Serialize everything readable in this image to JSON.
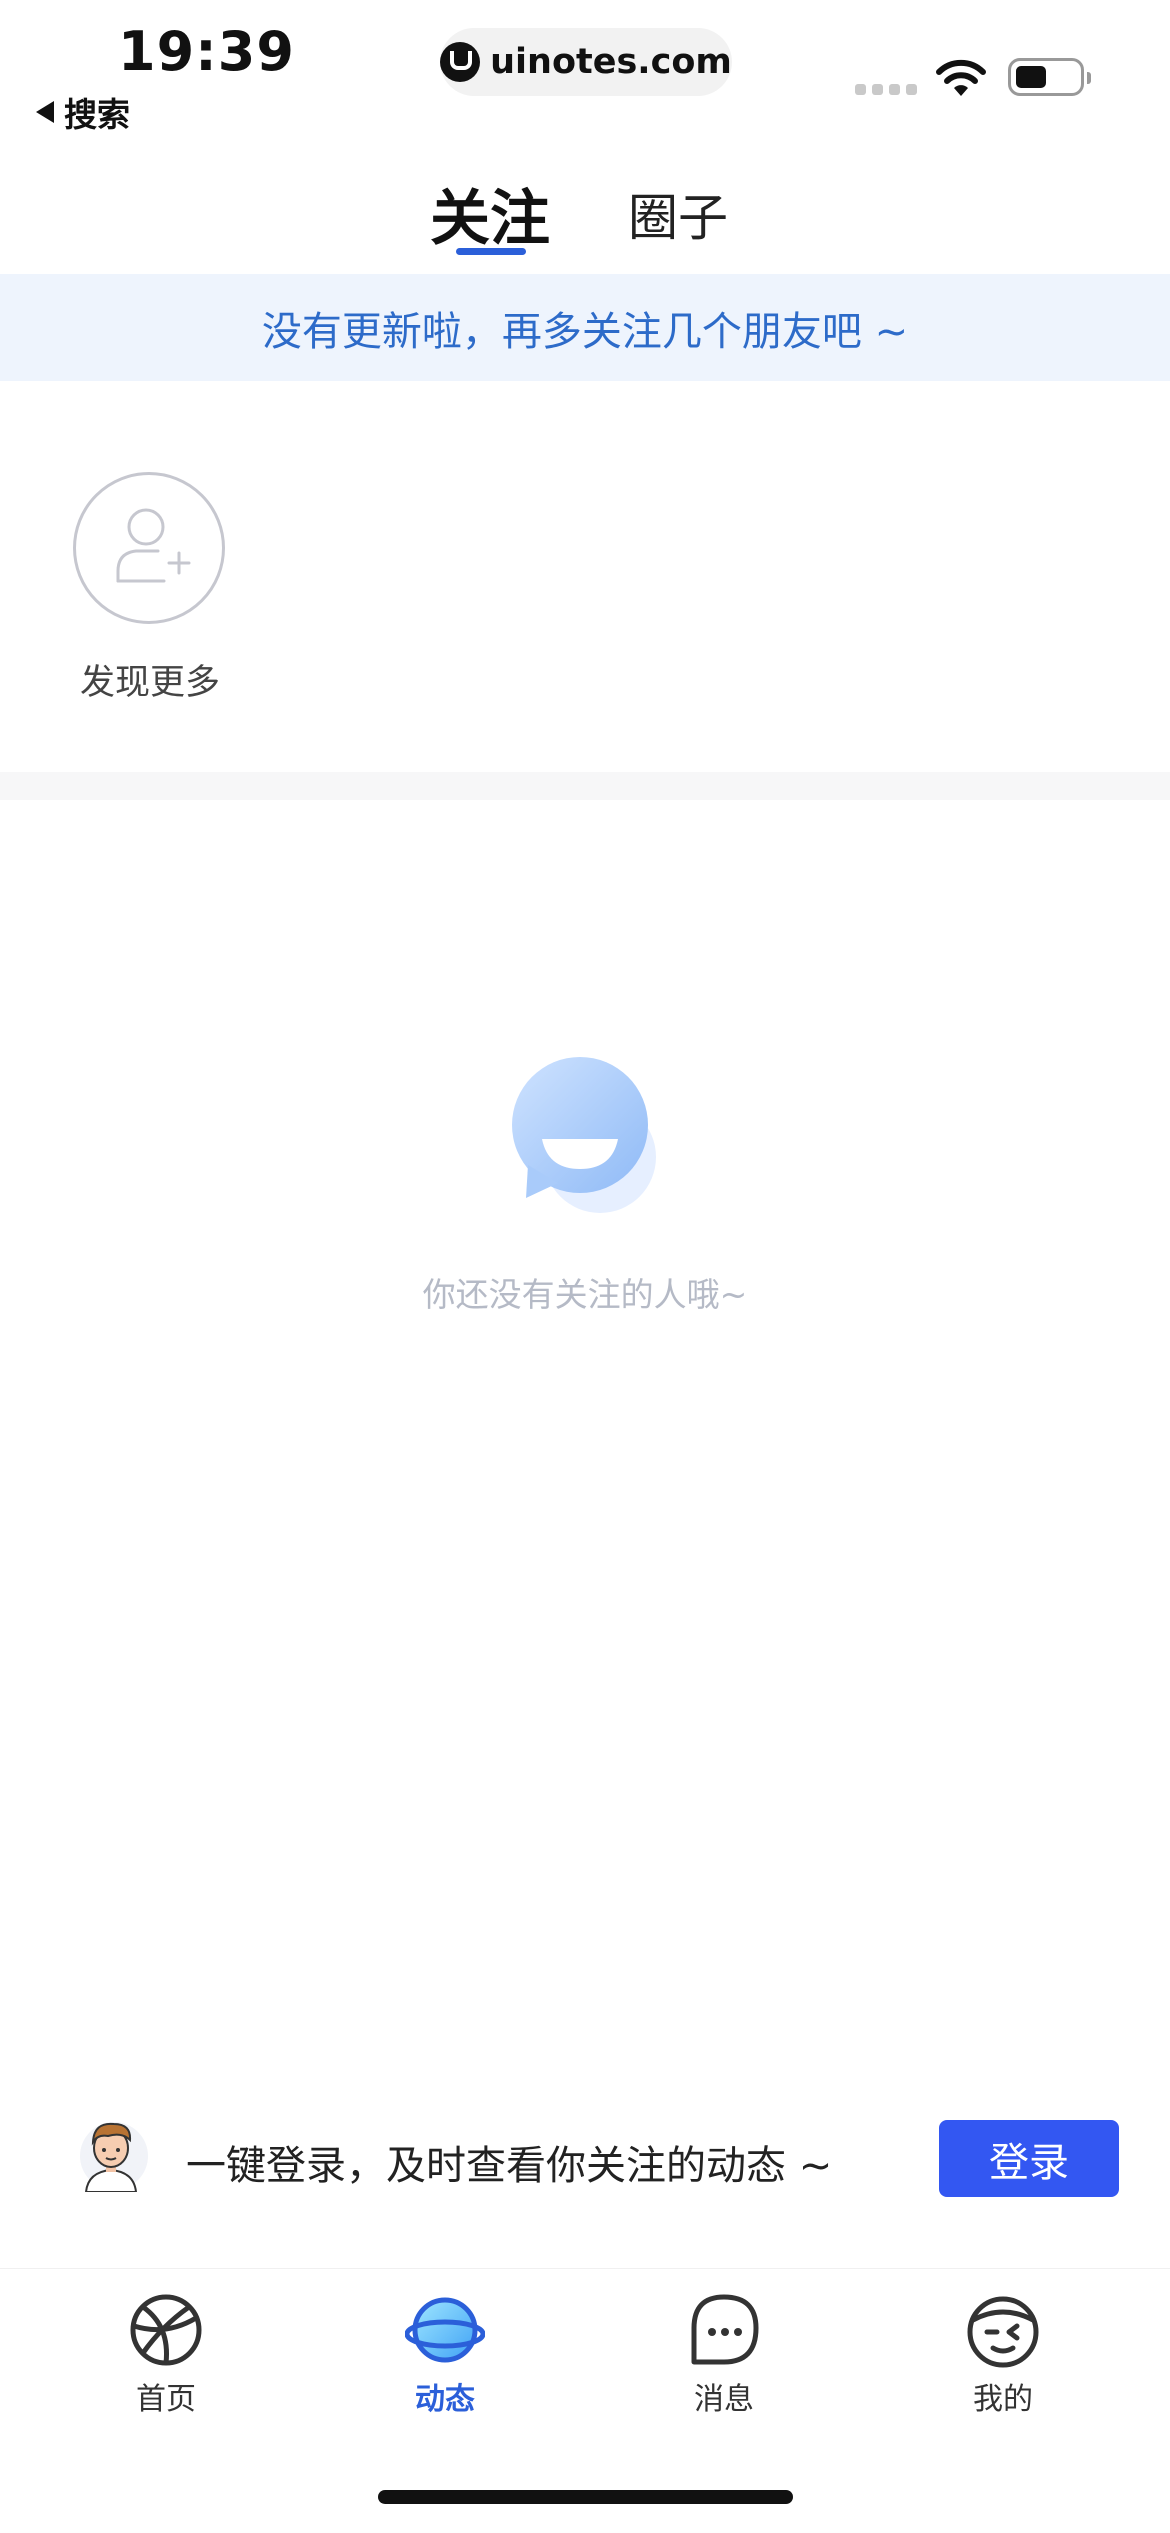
{
  "status_bar": {
    "time": "19:39",
    "back_label": "搜索",
    "url": "uinotes.com"
  },
  "tabs": [
    {
      "label": "关注",
      "active": true
    },
    {
      "label": "圈子",
      "active": false
    }
  ],
  "notice": "没有更新啦，再多关注几个朋友吧 ~",
  "discover": {
    "label": "发现更多",
    "icon": "add-user-icon"
  },
  "empty_state": {
    "text": "你还没有关注的人哦~",
    "icon": "smile-chat-icon"
  },
  "login_prompt": {
    "text": "一键登录，及时查看你关注的动态 ~",
    "button": "登录",
    "avatar_icon": "user-avatar-icon"
  },
  "bottom_nav": [
    {
      "label": "首页",
      "icon": "basketball-icon",
      "active": false
    },
    {
      "label": "动态",
      "icon": "planet-icon",
      "active": true
    },
    {
      "label": "消息",
      "icon": "chat-bubble-icon",
      "active": false
    },
    {
      "label": "我的",
      "icon": "face-icon",
      "active": false
    }
  ],
  "colors": {
    "accent": "#2b5fd9",
    "login_button": "#3357f2",
    "notice_bg": "#eef4fd",
    "notice_text": "#2d6bc9"
  }
}
